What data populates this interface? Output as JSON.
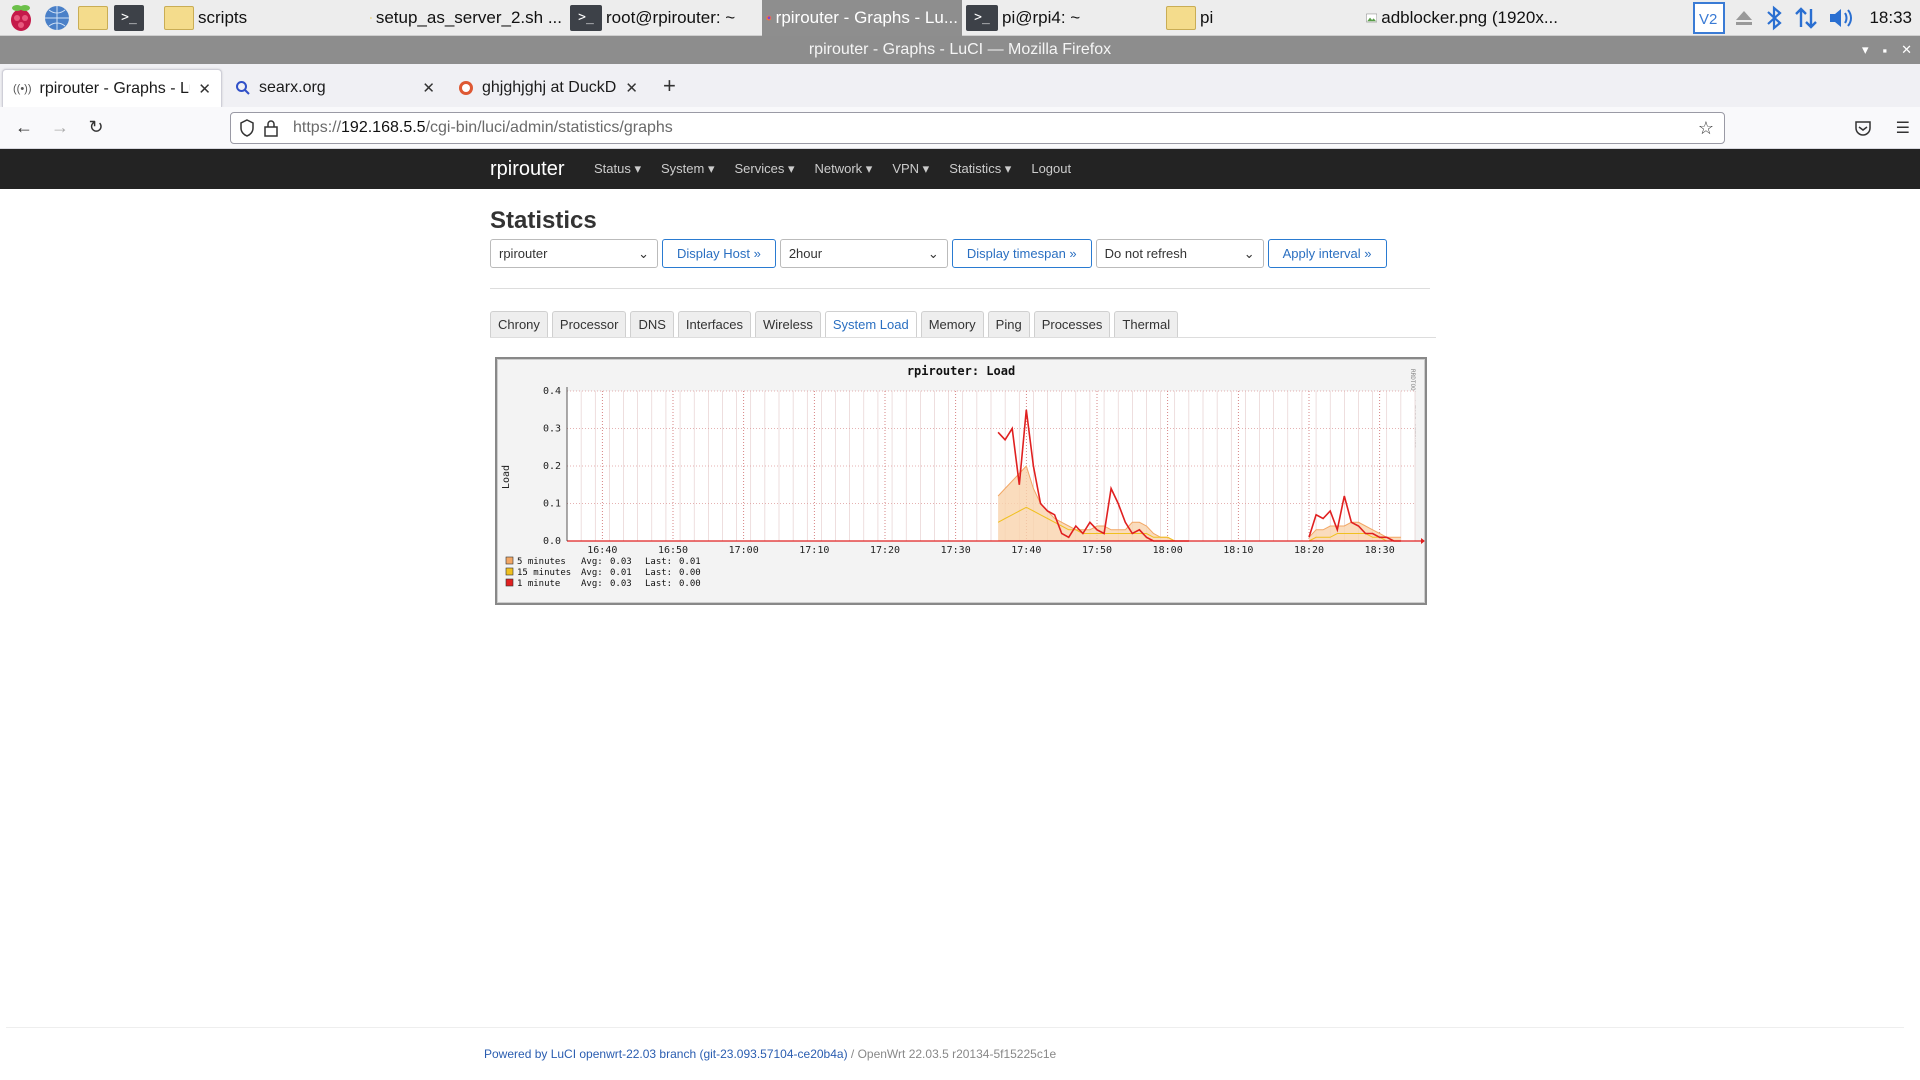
{
  "taskbar": {
    "tasks": [
      {
        "label": "scripts",
        "active": false
      },
      {
        "label": "setup_as_server_2.sh ...",
        "active": false
      },
      {
        "label": "root@rpirouter: ~",
        "active": false
      },
      {
        "label": "rpirouter - Graphs - Lu...",
        "active": true
      },
      {
        "label": "pi@rpi4: ~",
        "active": false
      },
      {
        "label": "pi",
        "active": false
      },
      {
        "label": "adblocker.png (1920x...",
        "active": false
      }
    ],
    "clock": "18:33"
  },
  "window": {
    "title": "rpirouter - Graphs - LuCI — Mozilla Firefox"
  },
  "browser": {
    "tabs": [
      {
        "title": "rpirouter - Graphs - LuCI",
        "active": true
      },
      {
        "title": "searx.org",
        "active": false
      },
      {
        "title": "ghjghjghj at DuckDuckGo",
        "active": false
      }
    ],
    "url_prefix": "https://",
    "url_host": "192.168.5.5",
    "url_path": "/cgi-bin/luci/admin/statistics/graphs"
  },
  "luci": {
    "brand": "rpirouter",
    "menu": [
      "Status ▾",
      "System ▾",
      "Services ▾",
      "Network ▾",
      "VPN ▾",
      "Statistics ▾",
      "Logout"
    ]
  },
  "page": {
    "title": "Statistics",
    "host_select": "rpirouter",
    "display_host_btn": "Display Host »",
    "timespan_select": "2hour",
    "display_timespan_btn": "Display timespan »",
    "refresh_select": "Do not refresh",
    "apply_interval_btn": "Apply interval »",
    "tabs": [
      "Chrony",
      "Processor",
      "DNS",
      "Interfaces",
      "Wireless",
      "System Load",
      "Memory",
      "Ping",
      "Processes",
      "Thermal"
    ],
    "active_tab": "System Load"
  },
  "chart_data": {
    "type": "area",
    "title": "rpirouter: Load",
    "ylabel": "Load",
    "side_label": "RRDTOOL / TOBI OETIKER",
    "ylim": [
      0,
      0.4
    ],
    "yticks": [
      "0.0",
      "0.1",
      "0.2",
      "0.3",
      "0.4"
    ],
    "xlim": [
      "16:35",
      "18:35"
    ],
    "xticks": [
      "16:40",
      "16:50",
      "17:00",
      "17:10",
      "17:20",
      "17:30",
      "17:40",
      "17:50",
      "18:00",
      "18:10",
      "18:20",
      "18:30"
    ],
    "x": [
      "17:36",
      "17:37",
      "17:38",
      "17:39",
      "17:40",
      "17:41",
      "17:42",
      "17:43",
      "17:44",
      "17:45",
      "17:46",
      "17:47",
      "17:48",
      "17:49",
      "17:50",
      "17:51",
      "17:52",
      "17:53",
      "17:54",
      "17:55",
      "17:56",
      "17:57",
      "17:58",
      "17:59",
      "18:00",
      "18:01",
      "18:02",
      "18:03",
      "18:20",
      "18:21",
      "18:22",
      "18:23",
      "18:24",
      "18:25",
      "18:26",
      "18:27",
      "18:28",
      "18:29",
      "18:30",
      "18:31",
      "18:32",
      "18:33"
    ],
    "series": [
      {
        "name": "5 minutes",
        "values": [
          0.12,
          0.14,
          0.16,
          0.18,
          0.2,
          0.14,
          0.1,
          0.08,
          0.06,
          0.05,
          0.04,
          0.03,
          0.03,
          0.03,
          0.04,
          0.04,
          0.03,
          0.03,
          0.03,
          0.05,
          0.05,
          0.04,
          0.02,
          0.01,
          0.01,
          0.0,
          0.0,
          0.0,
          0.01,
          0.03,
          0.03,
          0.04,
          0.04,
          0.04,
          0.05,
          0.05,
          0.04,
          0.03,
          0.02,
          0.01,
          0.01,
          0.01
        ]
      },
      {
        "name": "15 minutes",
        "values": [
          0.05,
          0.06,
          0.07,
          0.08,
          0.09,
          0.08,
          0.07,
          0.06,
          0.05,
          0.04,
          0.03,
          0.03,
          0.02,
          0.02,
          0.02,
          0.02,
          0.02,
          0.02,
          0.02,
          0.02,
          0.02,
          0.02,
          0.01,
          0.01,
          0.01,
          0.0,
          0.0,
          0.0,
          0.0,
          0.01,
          0.01,
          0.01,
          0.02,
          0.02,
          0.02,
          0.02,
          0.02,
          0.01,
          0.01,
          0.0,
          0.0,
          0.0
        ]
      },
      {
        "name": "1 minute",
        "values": [
          0.29,
          0.27,
          0.3,
          0.15,
          0.35,
          0.2,
          0.1,
          0.08,
          0.07,
          0.02,
          0.01,
          0.04,
          0.02,
          0.05,
          0.03,
          0.02,
          0.14,
          0.1,
          0.05,
          0.02,
          0.03,
          0.01,
          0.0,
          0.0,
          0.0,
          0.0,
          0.0,
          0.0,
          0.01,
          0.07,
          0.06,
          0.08,
          0.03,
          0.12,
          0.05,
          0.04,
          0.02,
          0.02,
          0.01,
          0.01,
          0.0,
          0.0
        ]
      }
    ],
    "legend": [
      {
        "name": "5 minutes",
        "avg": "0.03",
        "last": "0.01",
        "color": "#f2a765"
      },
      {
        "name": "15 minutes",
        "avg": "0.01",
        "last": "0.00",
        "color": "#f0c020"
      },
      {
        "name": "1 minute",
        "avg": "0.03",
        "last": "0.00",
        "color": "#e02020"
      }
    ],
    "avg_label": "Avg:",
    "last_label": "Last:"
  },
  "footer": {
    "link": "Powered by LuCI openwrt-22.03 branch (git-23.093.57104-ce20b4a)",
    "rest": " / OpenWrt 22.03.5 r20134-5f15225c1e"
  }
}
